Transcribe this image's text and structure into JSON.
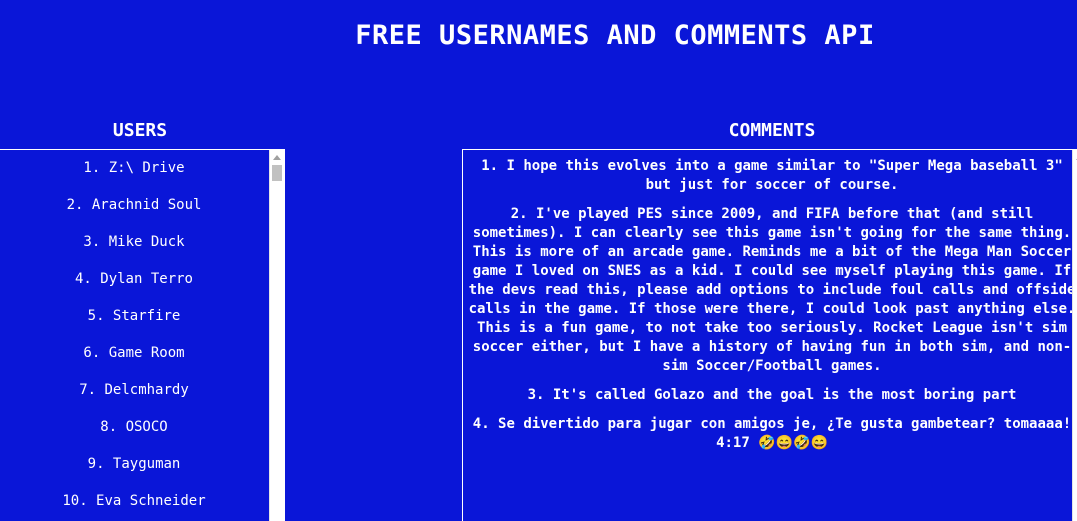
{
  "header": {
    "title": "FREE USERNAMES AND COMMENTS API"
  },
  "users": {
    "title": "USERS",
    "items": [
      "1. Z:\\ Drive",
      "2. Arachnid Soul",
      "3. Mike Duck",
      "4. Dylan Terro",
      "5. Starfire",
      "6. Game Room",
      "7. Delcmhardy",
      "8. OSOCO",
      "9. Tayguman",
      "10. Eva Schneider"
    ]
  },
  "comments": {
    "title": "COMMENTS",
    "items": [
      "1. I hope this evolves into a game similar to \"Super Mega baseball 3\" but just for soccer of course.",
      "2. I've played PES since 2009, and FIFA before that (and still sometimes). I can clearly see this game isn't going for the same thing. This is more of an arcade game. Reminds me a bit of the Mega Man Soccer game I loved on SNES as a kid. I could see myself playing this game. If the devs read this, please add options to include foul calls and offside calls in the game. If those were there, I could look past anything else. This is a fun game, to not take too seriously. Rocket League isn't sim soccer either, but I have a history of having fun in both sim, and non-sim Soccer/Football games.",
      "3. It's called Golazo and the goal is the most boring part",
      "4. Se divertido para jugar con amigos je, ¿Te gusta gambetear? tomaaaa! 4:17 🤣😄🤣😄"
    ]
  },
  "colors": {
    "background": "#0a16d8",
    "text": "#ffffff",
    "scrollbar_track": "#ffffff",
    "scrollbar_thumb": "#c1c1c1"
  }
}
